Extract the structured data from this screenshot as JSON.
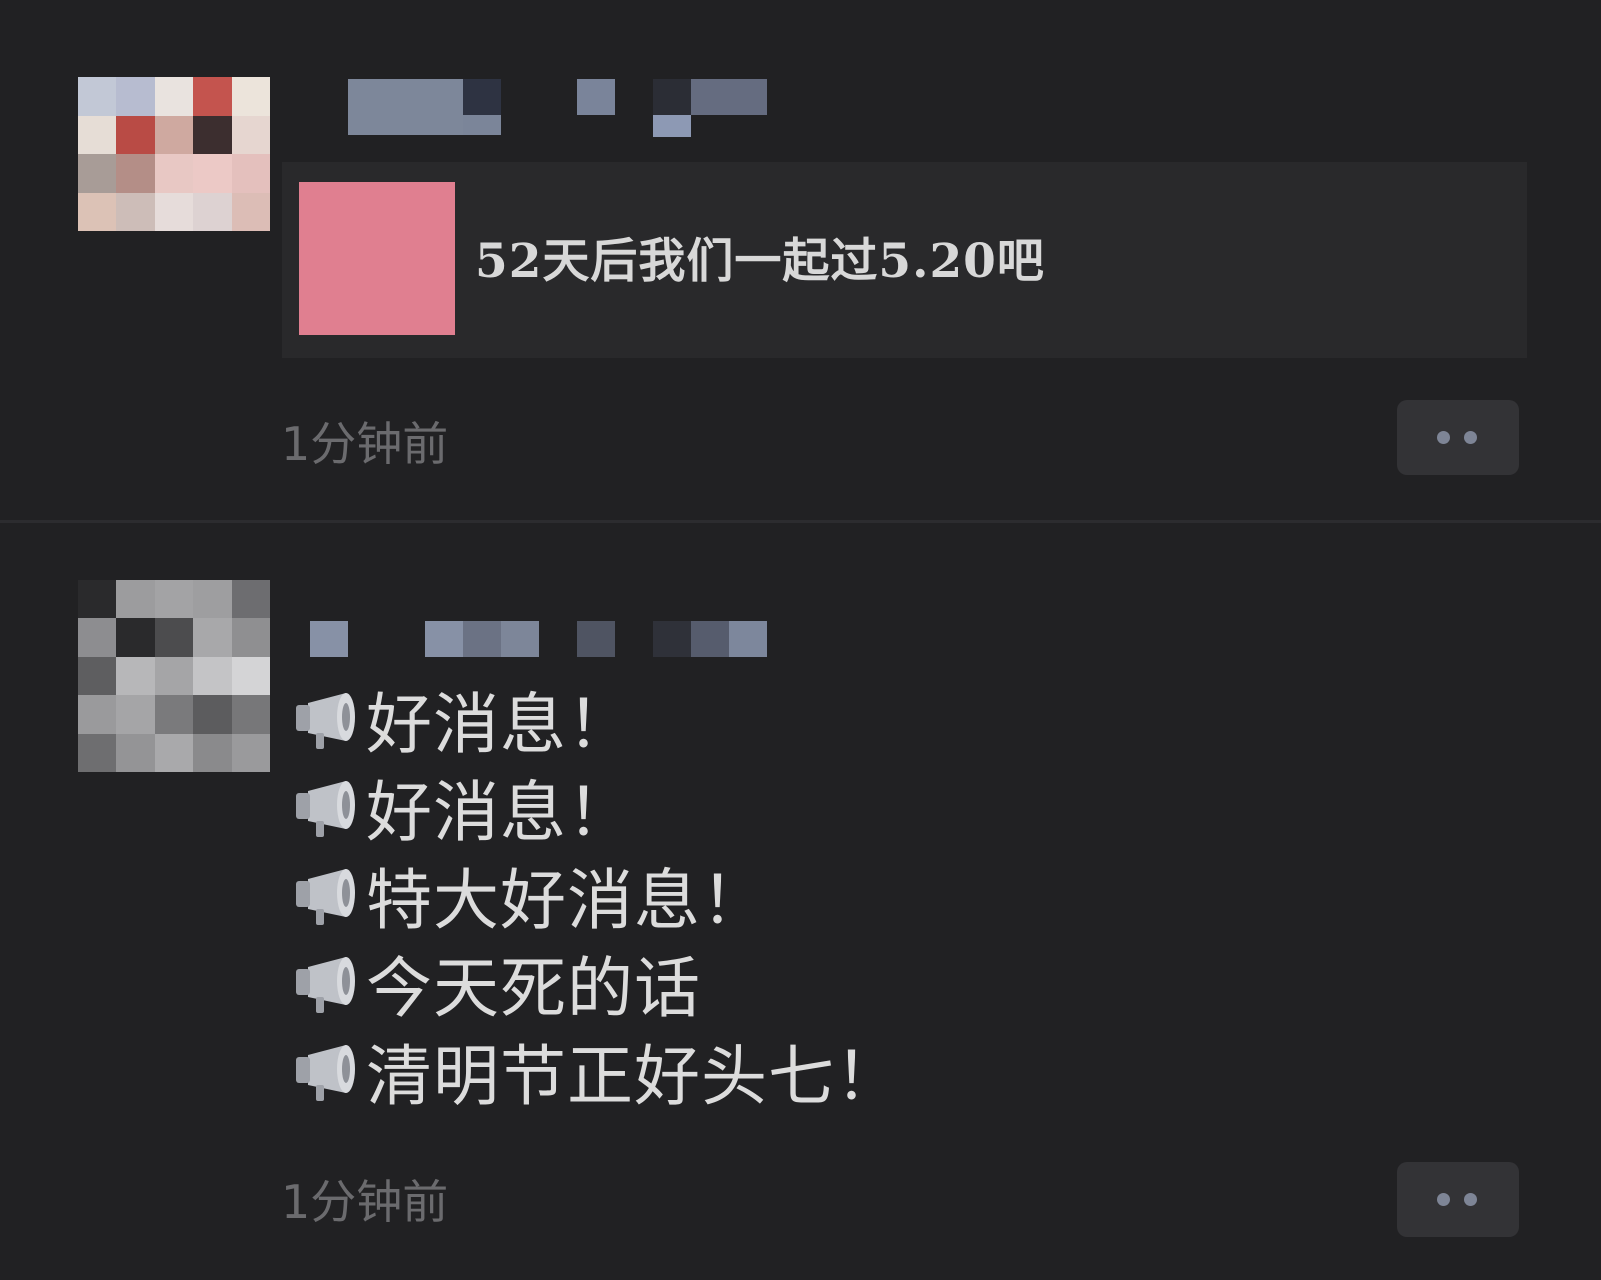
{
  "posts": [
    {
      "share_title": "52天后我们一起过5.20吧",
      "time": "1分钟前",
      "more_icon": "more-dots-icon"
    },
    {
      "lines": [
        {
          "icon": "megaphone-icon",
          "text": "好消息！"
        },
        {
          "icon": "megaphone-icon",
          "text": "好消息！"
        },
        {
          "icon": "megaphone-icon",
          "text": "特大好消息！"
        },
        {
          "icon": "megaphone-icon",
          "text": "今天死的话"
        },
        {
          "icon": "megaphone-icon",
          "text": "清明节正好头七！"
        }
      ],
      "time": "1分钟前",
      "more_icon": "more-dots-icon"
    }
  ],
  "colors": {
    "background": "#212123",
    "card": "#29292b",
    "thumbnail": "#e07f90",
    "time_text": "#6b6b6e",
    "more_dots": "#7e8596"
  }
}
